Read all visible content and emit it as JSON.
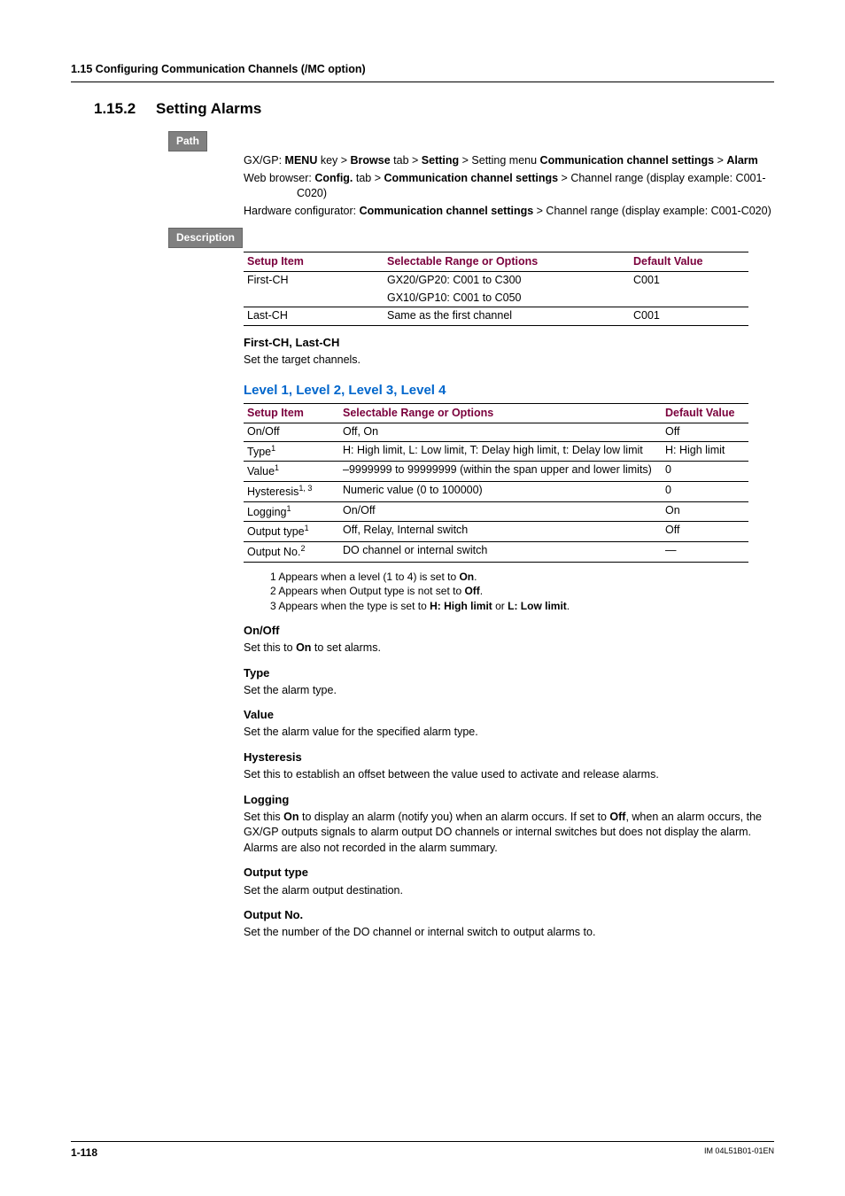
{
  "header": "1.15  Configuring Communication Channels (/MC option)",
  "heading": {
    "num": "1.15.2",
    "title": "Setting Alarms"
  },
  "labels": {
    "path": "Path",
    "description": "Description"
  },
  "path_lines": [
    "GX/GP: <b>MENU</b> key > <b>Browse</b> tab > <b>Setting</b> > Setting menu <b>Communication channel settings</b> > <b>Alarm</b>",
    "Web browser: <b>Config.</b> tab > <b>Communication channel settings</b> > Channel range (display example: C001-C020)",
    "Hardware configurator: <b>Communication channel settings</b> > Channel range (display example: C001-C020)"
  ],
  "table1": {
    "headers": [
      "Setup Item",
      "Selectable Range or Options",
      "Default Value"
    ],
    "rows": [
      [
        "First-CH",
        "GX20/GP20: C001 to C300",
        "C001"
      ],
      [
        "",
        "GX10/GP10: C001 to C050",
        ""
      ],
      [
        "Last-CH",
        "Same as the first channel",
        "C001"
      ]
    ]
  },
  "first_last": {
    "title": "First-CH, Last-CH",
    "text": "Set the target channels."
  },
  "level_heading": "Level 1, Level 2, Level 3, Level 4",
  "table2": {
    "headers": [
      "Setup Item",
      "Selectable Range or Options",
      "Default Value"
    ],
    "rows": [
      {
        "item": "On/Off",
        "sup": "",
        "opts": "Off, On",
        "def": "Off"
      },
      {
        "item": "Type",
        "sup": "1",
        "opts": "H: High limit, L: Low limit, T: Delay high limit, t: Delay low limit",
        "def": "H: High limit"
      },
      {
        "item": "Value",
        "sup": "1",
        "opts": "–9999999 to 99999999 (within the span upper and lower limits)",
        "def": "0"
      },
      {
        "item": "Hysteresis",
        "sup": "1, 3",
        "opts": "Numeric value (0 to 100000)",
        "def": "0"
      },
      {
        "item": "Logging",
        "sup": "1",
        "opts": "On/Off",
        "def": "On"
      },
      {
        "item": "Output type",
        "sup": "1",
        "opts": "Off, Relay, Internal switch",
        "def": "Off"
      },
      {
        "item": "Output No.",
        "sup": "2",
        "opts": "DO channel or internal switch",
        "def": "—"
      }
    ]
  },
  "footnotes": [
    "1  Appears when a level (1 to 4) is set to <b>On</b>.",
    "2  Appears when Output type is not set to <b>Off</b>.",
    "3  Appears when the type is set to <b>H: High limit</b> or <b>L: Low limit</b>."
  ],
  "sections": [
    {
      "title": "On/Off",
      "body": "Set this to <b>On</b> to set alarms."
    },
    {
      "title": "Type",
      "body": "Set the alarm type."
    },
    {
      "title": "Value",
      "body": "Set the alarm value for the specified alarm type."
    },
    {
      "title": "Hysteresis",
      "body": "Set this to establish an offset between the value used to activate and release alarms."
    },
    {
      "title": "Logging",
      "body": "Set this <b>On</b> to display an alarm (notify you) when an alarm occurs. If set to <b>Off</b>, when an alarm occurs, the GX/GP outputs signals to alarm output DO channels or internal switches but does not display the alarm. Alarms are also not recorded in the alarm summary."
    },
    {
      "title": "Output type",
      "body": "Set the alarm output destination."
    },
    {
      "title": "Output No.",
      "body": "Set the number of the DO channel or internal switch to output alarms to."
    }
  ],
  "footer": {
    "page": "1-118",
    "doc": "IM 04L51B01-01EN"
  }
}
